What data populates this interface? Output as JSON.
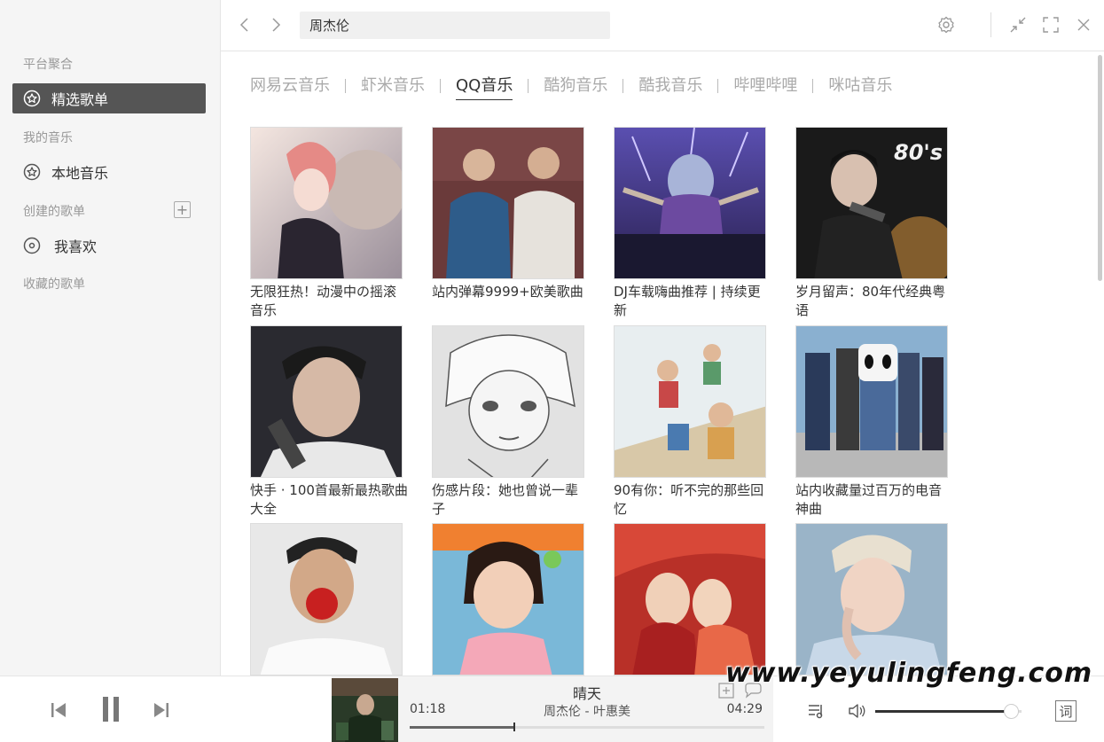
{
  "sidebar": {
    "section_platform": "平台聚合",
    "item_featured": "精选歌单",
    "section_my_music": "我的音乐",
    "item_local": "本地音乐",
    "section_created": "创建的歌单",
    "item_liked": "我喜欢",
    "section_collected": "收藏的歌单"
  },
  "topbar": {
    "search_value": "周杰伦"
  },
  "tabs": [
    {
      "label": "网易云音乐",
      "active": false
    },
    {
      "label": "虾米音乐",
      "active": false
    },
    {
      "label": "QQ音乐",
      "active": true
    },
    {
      "label": "酷狗音乐",
      "active": false
    },
    {
      "label": "酷我音乐",
      "active": false
    },
    {
      "label": "哔哩哔哩",
      "active": false
    },
    {
      "label": "咪咕音乐",
      "active": false
    }
  ],
  "playlists": [
    {
      "title": "无限狂热！动漫中の摇滚音乐"
    },
    {
      "title": "站内弹幕9999+欧美歌曲"
    },
    {
      "title": "DJ车载嗨曲推荐 | 持续更新"
    },
    {
      "title": "岁月留声：80年代经典粤语"
    },
    {
      "title": "快手 · 100首最新最热歌曲大全"
    },
    {
      "title": "伤感片段：她也曾说一辈子"
    },
    {
      "title": "90有你：听不完的那些回忆"
    },
    {
      "title": "站内收藏量过百万的电音神曲"
    },
    {
      "title": ""
    },
    {
      "title": ""
    },
    {
      "title": ""
    },
    {
      "title": ""
    }
  ],
  "cover_badge_80s": "80's",
  "player": {
    "title": "晴天",
    "artist": "周杰伦 - 叶惠美",
    "current_time": "01:18",
    "total_time": "04:29",
    "progress": 0.295,
    "volume": 0.93,
    "lyric_button": "词"
  },
  "watermark": "www.yeyulingfeng.com"
}
